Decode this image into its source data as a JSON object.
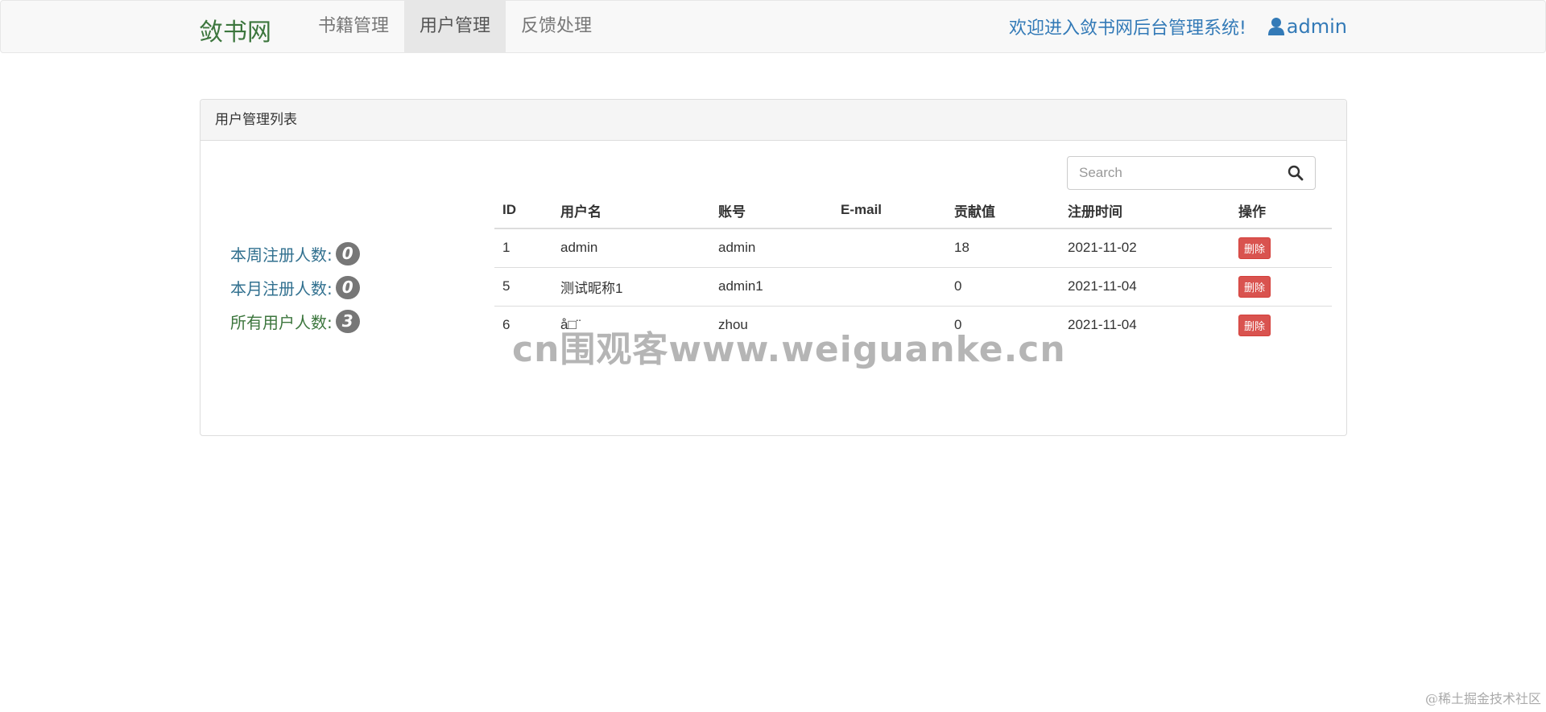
{
  "navbar": {
    "brand": "敛书网",
    "items": [
      {
        "label": "书籍管理",
        "active": false
      },
      {
        "label": "用户管理",
        "active": true
      },
      {
        "label": "反馈处理",
        "active": false
      }
    ],
    "welcome": "欢迎进入敛书网后台管理系统!",
    "user": "admin"
  },
  "panel": {
    "title": "用户管理列表",
    "stats": [
      {
        "label": "本周注册人数:",
        "value": "0"
      },
      {
        "label": "本月注册人数:",
        "value": "0"
      },
      {
        "label": "所有用户人数:",
        "value": "3"
      }
    ],
    "search": {
      "placeholder": "Search",
      "value": ""
    },
    "table": {
      "headers": [
        "ID",
        "用户名",
        "账号",
        "E-mail",
        "贡献值",
        "注册时间",
        "操作"
      ],
      "rows": [
        {
          "id": "1",
          "username": "admin",
          "account": "admin",
          "email": "",
          "contribution": "18",
          "registered": "2021-11-02",
          "action": "删除"
        },
        {
          "id": "5",
          "username": "测试昵称1",
          "account": "admin1",
          "email": "",
          "contribution": "0",
          "registered": "2021-11-04",
          "action": "删除"
        },
        {
          "id": "6",
          "username": "å□¨",
          "account": "zhou",
          "email": "",
          "contribution": "0",
          "registered": "2021-11-04",
          "action": "删除"
        }
      ]
    }
  },
  "watermark": "cn围观客www.weiguanke.cn",
  "corner_watermark": "@稀土掘金技术社区",
  "colors": {
    "brand": "#3c763d",
    "link": "#337ab7",
    "danger": "#d9534f",
    "badge": "#777777"
  }
}
